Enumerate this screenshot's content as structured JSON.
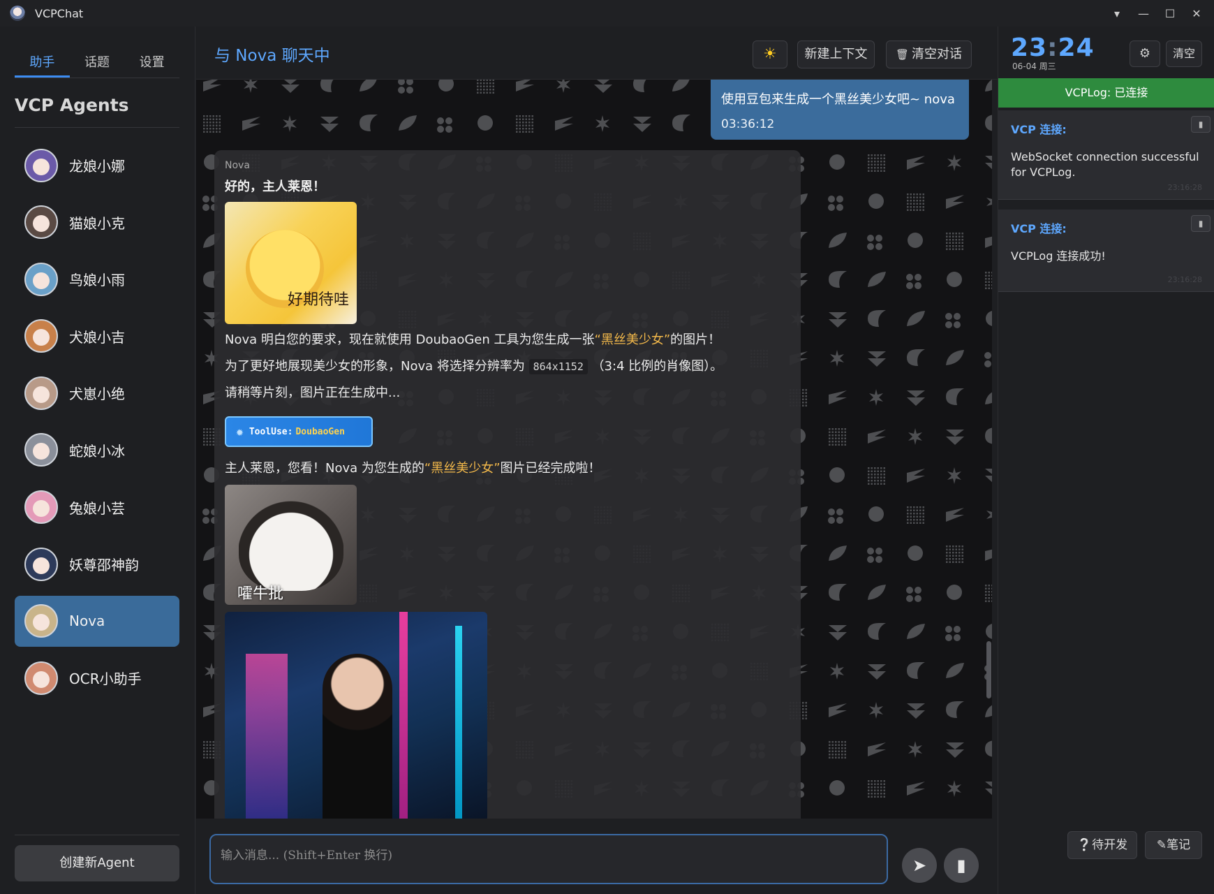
{
  "window": {
    "title": "VCPChat",
    "controls": [
      "▾",
      "—",
      "☐",
      "✕"
    ]
  },
  "sidebar": {
    "tabs": [
      {
        "label": "助手",
        "active": true
      },
      {
        "label": "话题",
        "active": false
      },
      {
        "label": "设置",
        "active": false
      }
    ],
    "section_title": "VCP Agents",
    "agents": [
      {
        "name": "龙娘小娜",
        "active": false
      },
      {
        "name": "猫娘小克",
        "active": false
      },
      {
        "name": "鸟娘小雨",
        "active": false
      },
      {
        "name": "犬娘小吉",
        "active": false
      },
      {
        "name": "犬崽小绝",
        "active": false
      },
      {
        "name": "蛇娘小冰",
        "active": false
      },
      {
        "name": "兔娘小芸",
        "active": false
      },
      {
        "name": "妖尊邵神韵",
        "active": false
      },
      {
        "name": "Nova",
        "active": true
      },
      {
        "name": "OCR小助手",
        "active": false
      }
    ],
    "new_agent_label": "创建新Agent"
  },
  "chat": {
    "title": "与 Nova 聊天中",
    "theme_icon": "☀",
    "new_context_label": "新建上下文",
    "clear_label": "清空对话",
    "clear_icon": "🗑"
  },
  "user_message": {
    "text": "使用豆包来生成一个黑丝美少女吧~ nova",
    "time": "03:36:12"
  },
  "ai_message": {
    "sender": "Nova",
    "greeting": "好的，主人莱恩！",
    "sticker1_caption": "好期待哇",
    "line1_a": "Nova 明白您的要求，现在就使用 DoubaoGen 工具为您生成一张",
    "line1_hl": "“黑丝美少女”",
    "line1_b": "的图片！",
    "line2_a": "为了更好地展现美少女的形象，Nova 将选择分辨率为 ",
    "line2_code": "864x1152",
    "line2_b": " （3:4 比例的肖像图）。",
    "line3": "请稍等片刻，图片正在生成中...",
    "tooluse_label": "ToolUse:",
    "tooluse_value": "DoubaoGen",
    "line4_a": "主人莱恩，您看！Nova 为您生成的",
    "line4_hl": "“黑丝美少女”",
    "line4_b": "图片已经完成啦！",
    "sticker2_caption": "嚯牛批"
  },
  "input": {
    "placeholder": "输入消息... (Shift+Enter 换行)",
    "value": "",
    "send_icon": "➤",
    "attach_icon": "▮"
  },
  "right_panel": {
    "clock_hour": "23",
    "clock_sep": ":",
    "clock_min": "24",
    "date": "06-04 周三",
    "settings_icon": "⚙",
    "clear_label": "清空",
    "status": "VCPLog: 已连接",
    "logs": [
      {
        "title": "VCP 连接:",
        "body": "WebSocket connection successful for VCPLog.",
        "time": "23:16:28"
      },
      {
        "title": "VCP 连接:",
        "body": "VCPLog 连接成功!",
        "time": "23:16:28"
      }
    ],
    "dev_label": "❔待开发",
    "notes_label": "✎笔记"
  },
  "colors": {
    "accent": "#5ea8ff",
    "active_agent": "#3a6b9a",
    "status_green": "#2e8b3e",
    "highlight": "#f2b84a"
  }
}
